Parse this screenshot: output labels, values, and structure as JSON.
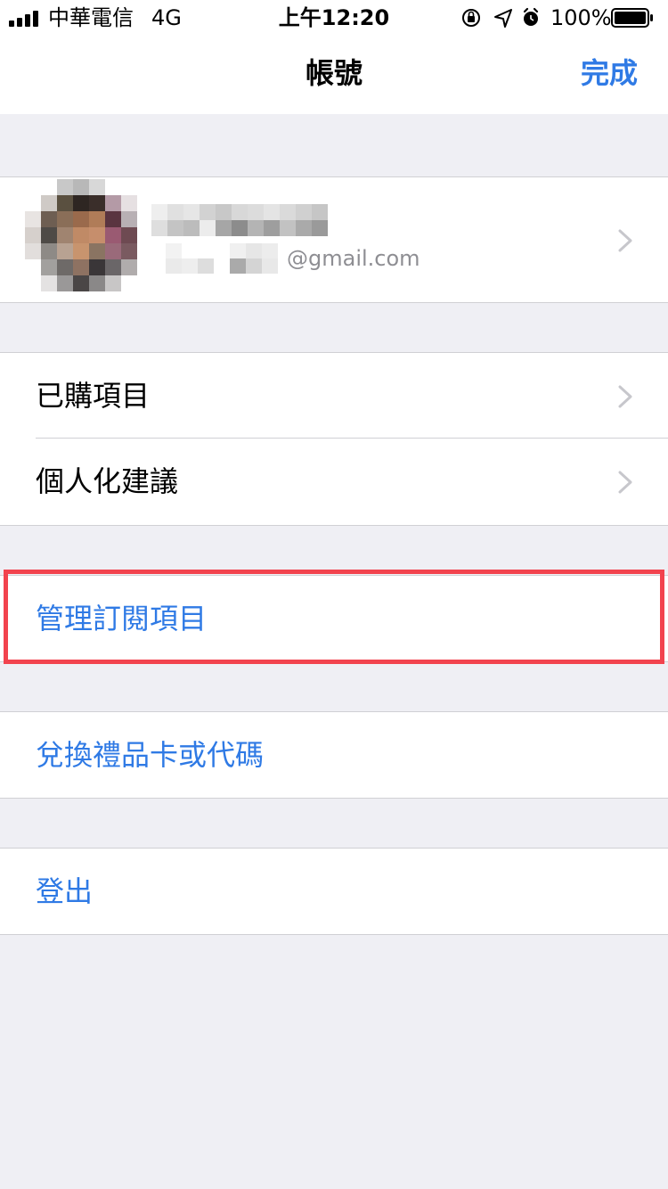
{
  "status_bar": {
    "carrier": "中華電信",
    "network": "4G",
    "time": "上午12:20",
    "battery_percent": "100%",
    "icons": [
      "orientation-lock-icon",
      "location-icon",
      "alarm-icon",
      "battery-icon"
    ]
  },
  "nav": {
    "title": "帳號",
    "done_label": "完成"
  },
  "account": {
    "email_domain": "@gmail.com"
  },
  "menu": {
    "purchased_label": "已購項目",
    "personalized_label": "個人化建議",
    "manage_subscriptions_label": "管理訂閱項目",
    "redeem_label": "兌換禮品卡或代碼",
    "sign_out_label": "登出"
  },
  "colors": {
    "accent": "#2f7ae5",
    "background": "#efeff4",
    "highlight": "#f2434e"
  }
}
